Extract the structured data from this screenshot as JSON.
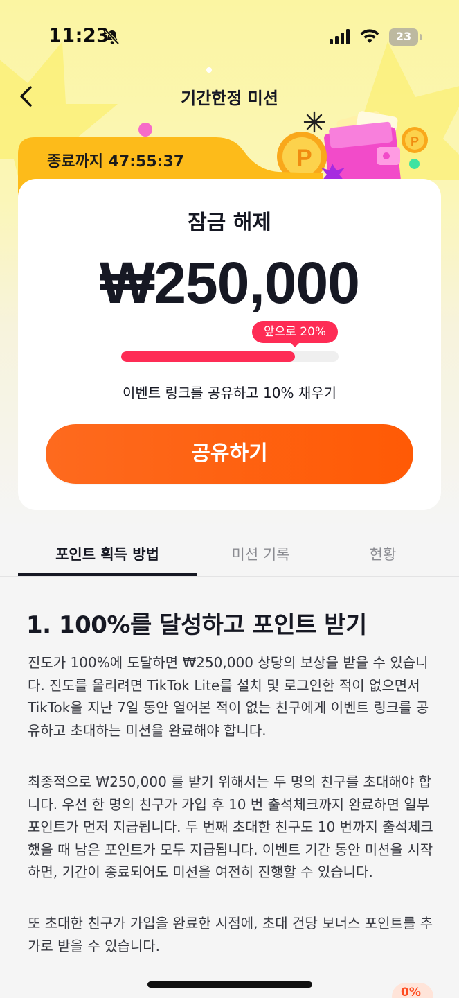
{
  "status_bar": {
    "time": "11:23",
    "battery": "23"
  },
  "nav": {
    "title": "기간한정 미션"
  },
  "countdown": {
    "text": "종료까지 47:55:37"
  },
  "reward_card": {
    "unlock_label": "잠금 해제",
    "amount": "₩250,000",
    "remaining_label": "앞으로 20%",
    "progress_fraction": 0.8,
    "share_hint": "이벤트 링크를 공유하고 10% 채우기",
    "share_button": "공유하기"
  },
  "tabs": [
    {
      "label": "포인트 획득 방법",
      "active": true
    },
    {
      "label": "미션 기록",
      "active": false
    },
    {
      "label": "현황",
      "active": false
    }
  ],
  "content": {
    "section_title": "1. 100%를 달성하고 포인트 받기",
    "paragraphs": [
      "진도가 100%에 도달하면 ₩250,000 상당의 보상을 받을 수 있습니다. 진도를 올리려면 TikTok Lite를 설치 및 로그인한 적이 없으면서 TikTok을 지난 7일 동안 열어본 적이 없는 친구에게 이벤트 링크를 공유하고 초대하는 미션을 완료해야 합니다.",
      "최종적으로 ₩250,000 를 받기 위해서는 두 명의 친구를 초대해야 합니다. 우선 한 명의 친구가 가입 후 10 번 출석체크까지 완료하면 일부 포인트가 먼저 지급됩니다. 두 번째 초대한 친구도 10 번까지 출석체크했을 때 남은 포인트가 모두 지급됩니다. 이벤트 기간 동안 미션을 시작하면, 기간이 종료되어도 미션을 여전히 진행할 수 있습니다.",
      "또 초대한 친구가 가입을 완료한 시점에, 초대 건당 보너스 포인트를 추가로 받을 수 있습니다."
    ]
  },
  "bottom_badge": "0%",
  "colors": {
    "accent_red": "#fe2c55",
    "button_orange": "#ff5a05",
    "hero_yellow": "#fbf5a2",
    "tab_orange": "#fdbb1a"
  }
}
